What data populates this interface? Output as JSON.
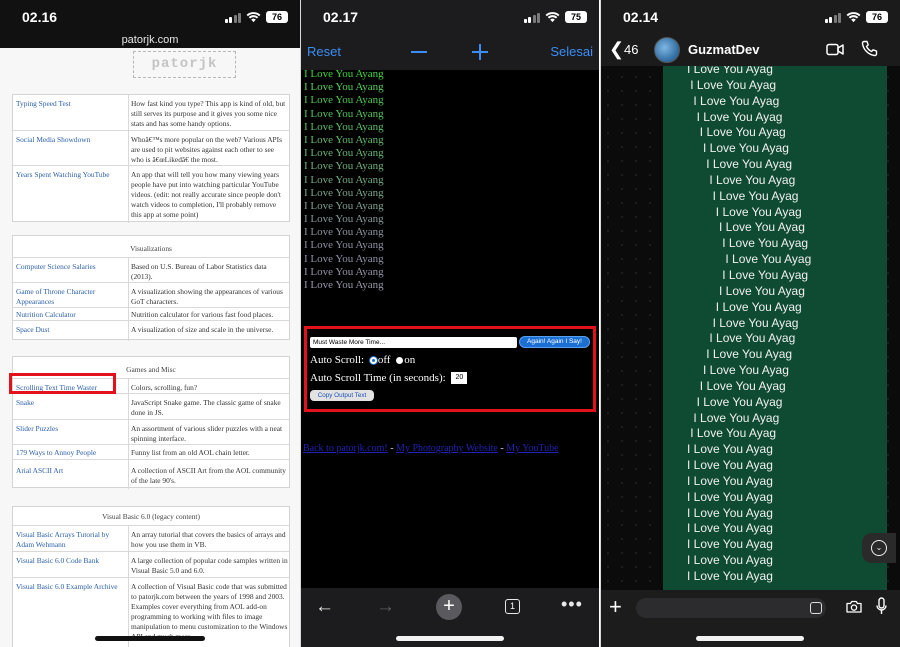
{
  "panel1": {
    "status": {
      "time": "02.16",
      "battery": "76"
    },
    "url": "patorjk.com",
    "logo_text": "patorjk",
    "section_top": {
      "rows": [
        {
          "link": "Typing Speed Test",
          "desc": "How fast kind you type? This app is kind of old, but still serves its purpose and it gives you some nice stats and has some handy options."
        },
        {
          "link": "Social Media Showdown",
          "desc": "Whoâ€™s more popular on the web? Various APIs are used to pit websites against each other to see who is â€œLikedâ€ the most."
        },
        {
          "link": "Years Spent Watching YouTube",
          "desc": "An app that will tell you how many viewing years people have put into watching particular YouTube videos. (edit: not really accurate since people don't watch videos to completion, I'll probably remove this app at some point)"
        }
      ]
    },
    "visualizations": {
      "header": "Visualizations",
      "rows": [
        {
          "link": "Computer Science Salaries",
          "desc": "Based on U.S. Bureau of Labor Statistics data (2013)."
        },
        {
          "link": "Game of Throne Character Appearances",
          "desc": "A visualization showing the appearances of various GoT characters."
        },
        {
          "link": "Nutrition Calculator",
          "desc": "Nutrition calculator for various fast food places."
        },
        {
          "link": "Space Dust",
          "desc": "A visualization of size and scale in the universe."
        }
      ]
    },
    "games": {
      "header": "Games and Misc",
      "rows": [
        {
          "link": "Scrolling Text Time Waster",
          "desc": "Colors, scrolling, fun?"
        },
        {
          "link": "Snake",
          "desc": "JavaScript Snake game. The classic game of snake done in JS."
        },
        {
          "link": "Slider Puzzles",
          "desc": "An assortment of various slider puzzles with a neat spinning interface."
        },
        {
          "link": "179 Ways to Annoy People",
          "desc": "Funny list from an old AOL chain letter."
        },
        {
          "link": "Arial ASCII Art",
          "desc": "A collection of ASCII Art from the AOL community of the late 90's."
        }
      ]
    },
    "vb": {
      "header": "Visual Basic 6.0 (legacy content)",
      "rows": [
        {
          "link": "Visual Basic Arrays Tutorial by Adam Wehmann",
          "desc": "An array tutorial that covers the basics of arrays and how you use them in VB."
        },
        {
          "link": "Visual Basic 6.0 Code Bank",
          "desc": "A large collection of popular code samples written in Visual Basic 5.0 and 6.0."
        },
        {
          "link": "Visual Basic 6.0 Example Archive",
          "desc": "A collection of Visual Basic code that was submitted to patorjk.com between the years of 1998 and 2003. Examples cover everything from AOL add-on programming to working with files to image manipulation to menu customization to the Windows API and much more."
        }
      ]
    }
  },
  "panel2": {
    "status": {
      "time": "02.17",
      "battery": "75"
    },
    "nav": {
      "reset": "Reset",
      "done": "Selesai"
    },
    "love_text": "I Love You Ayang",
    "love_colors": [
      "#3fd63f",
      "#57cf5b",
      "#4fc753",
      "#55c45e",
      "#5cbf66",
      "#62ba6d",
      "#68b574",
      "#6eb07c",
      "#74aa83",
      "#7aa58a",
      "#7fa091",
      "#859a98",
      "#8a959e",
      "#8f90a3",
      "#9090a6",
      "#9494a8",
      "#9898aa"
    ],
    "controls": {
      "message_value": "Must Waste More Time...",
      "again_button": "Again! Again I Say!",
      "autoscroll_label": "Auto Scroll:",
      "off_label": "off",
      "on_label": "on",
      "scroll_time_label": "Auto Scroll Time (in seconds):",
      "scroll_time_value": "20",
      "copy_button": "Copy Output Text"
    },
    "links": {
      "back": "Back to patorjk.com!",
      "sep": " - ",
      "photography": "My Photography Website",
      "youtube": "My YouTube"
    },
    "bottom": {
      "tab_count": "1"
    }
  },
  "panel3": {
    "status": {
      "time": "02.14",
      "battery": "76"
    },
    "back_count": "46",
    "contact_name": "GuzmatDev",
    "messages": [
      "I Love You Ayag",
      "I Love You Ayag",
      "I Love You Ayag",
      "I Love You Ayag",
      "I Love You Ayag",
      "I Love You Ayag",
      "I Love You Ayag",
      "I Love You Ayag",
      "I Love You Ayag",
      "I Love You Ayag",
      "I Love You Ayag",
      "I Love You Ayag",
      "I Love You Ayag",
      "I Love You Ayag",
      "I Love You Ayag",
      "I Love You Ayag",
      "I Love You Ayag",
      "I Love You Ayag",
      "I Love You Ayag",
      "I Love You Ayag",
      "I Love You Ayag",
      "I Love You Ayag",
      "I Love You Ayag",
      "I Love You Ayag",
      "I Love You Ayag",
      "I Love You Ayag",
      "I Love You Ayag",
      "I Love You Ayag",
      "I Love You Ayag",
      "I Love You Ayag",
      "I Love You Ayag",
      "I Love You Ayag",
      "I Love You Ayag"
    ]
  },
  "colors": {
    "highlight": "#e3111b",
    "ios_blue": "#3a8ef6",
    "wa_bubble": "#0f4b32",
    "link_blue": "#2a5fa8"
  }
}
